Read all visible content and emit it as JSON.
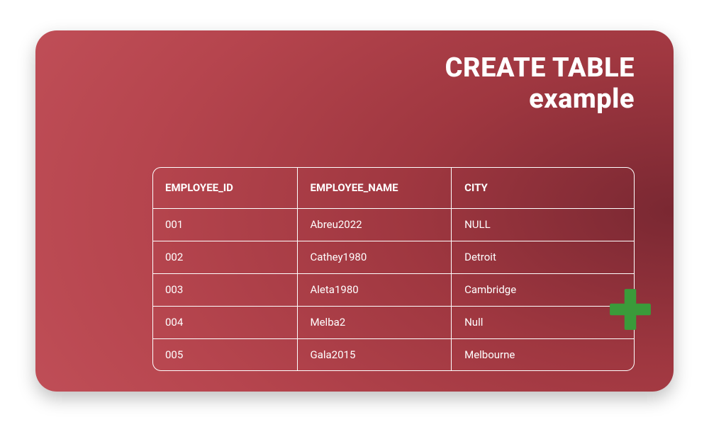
{
  "title": {
    "line1": "CREATE TABLE",
    "line2": "example"
  },
  "table": {
    "columns": [
      "EMPLOYEE_ID",
      "EMPLOYEE_NAME",
      "CITY"
    ],
    "rows": [
      {
        "employee_id": "001",
        "employee_name": "Abreu2022",
        "city": "NULL"
      },
      {
        "employee_id": "002",
        "employee_name": "Cathey1980",
        "city": "Detroit"
      },
      {
        "employee_id": "003",
        "employee_name": "Aleta1980",
        "city": "Cambridge"
      },
      {
        "employee_id": "004",
        "employee_name": "Melba2",
        "city": "Null"
      },
      {
        "employee_id": "005",
        "employee_name": "Gala2015",
        "city": "Melbourne"
      }
    ]
  },
  "icons": {
    "plus": "plus-icon"
  },
  "colors": {
    "card_gradient_dark": "#7a2832",
    "card_gradient_light": "#c95760",
    "plus_icon": "#3a9b3a",
    "text": "#ffffff"
  }
}
